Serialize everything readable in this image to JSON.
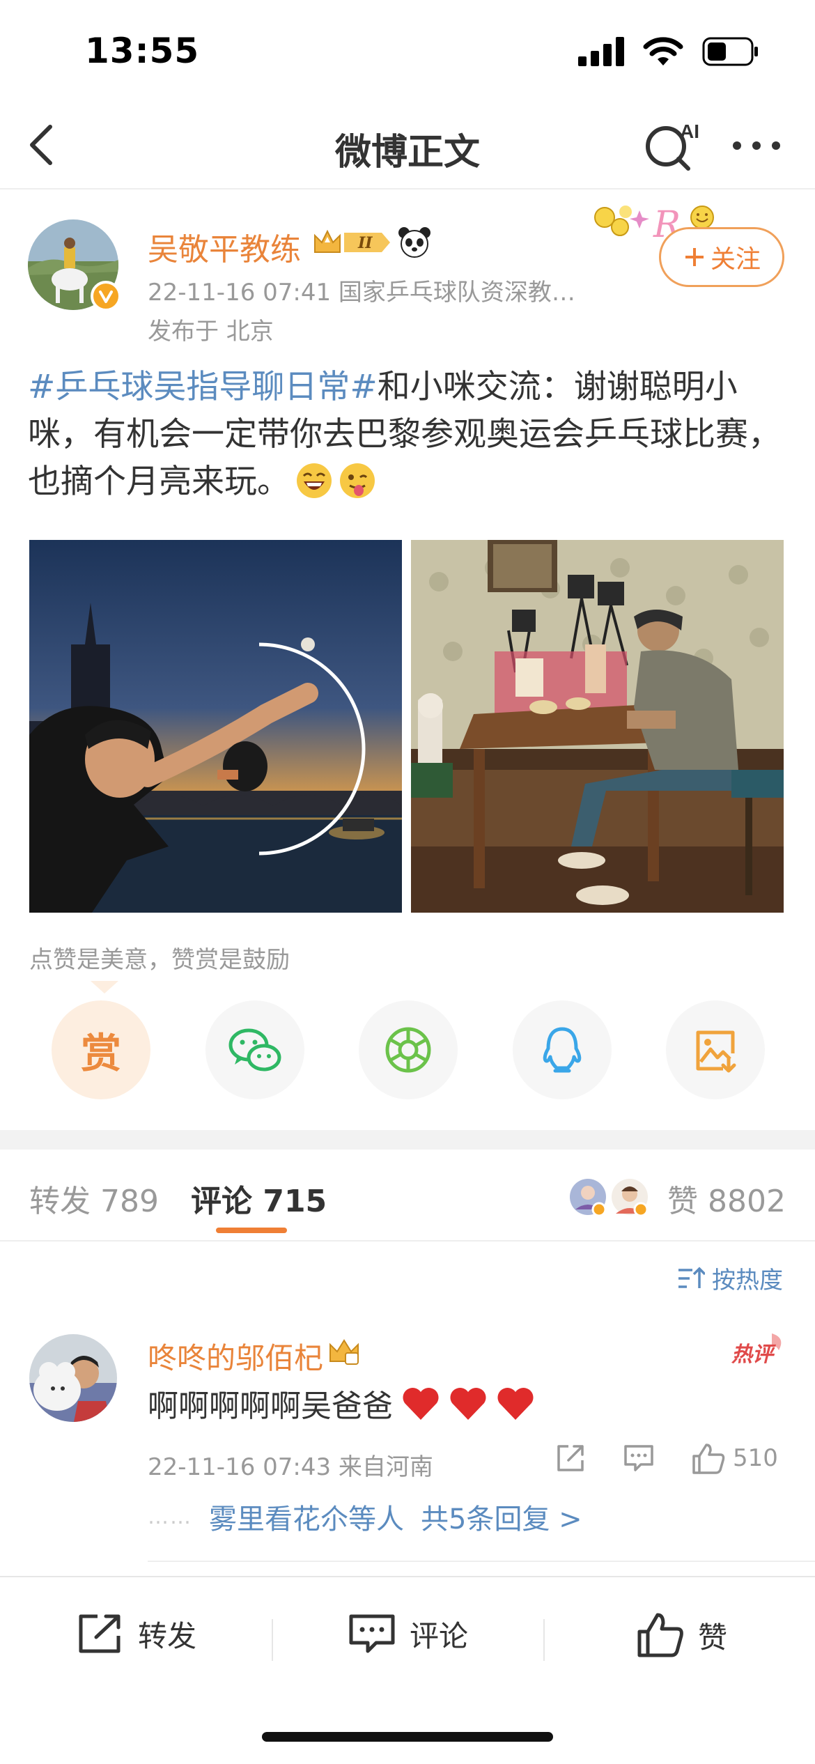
{
  "status": {
    "time": "13:55"
  },
  "nav": {
    "title": "微博正文",
    "ai_label": "AI"
  },
  "post": {
    "author": "吴敬平教练",
    "crown_level": "II",
    "meta": "22-11-16 07:41  国家乒乓球队资深教…",
    "location": "发布于 北京",
    "follow_label": "关注",
    "topic": "#乒乓球吴指导聊日常#",
    "text": "和小咪交流：谢谢聪明小咪，有机会一定带你去巴黎参观奥运会乒乓球比赛，也摘个月亮来玩。"
  },
  "reward": {
    "hint": "点赞是美意，赞赏是鼓励",
    "reward_label": "赏",
    "share_icons": [
      "wechat-icon",
      "moments-icon",
      "qq-icon",
      "save-image-icon"
    ]
  },
  "tabs": {
    "repost_label": "转发",
    "repost_count": "789",
    "comment_label": "评论",
    "comment_count": "715",
    "like_label": "赞",
    "like_count": "8802"
  },
  "sort_label": "按热度",
  "comment": {
    "name": "咚咚的邬佰杞",
    "hot_label": "热评",
    "text": "啊啊啊啊啊吴爸爸",
    "meta": "22-11-16 07:43 来自河南",
    "like_count": "510",
    "reply_dots": "……",
    "reply_text": "雾里看花尒等人",
    "reply_count_text": "共5条回复 >"
  },
  "bottom_bar": {
    "repost_label": "转发",
    "comment_label": "评论",
    "like_label": "赞"
  },
  "colors": {
    "accent_orange": "#ef7f35",
    "link_blue": "#5b8bbf",
    "name_orange": "#e9843a"
  }
}
